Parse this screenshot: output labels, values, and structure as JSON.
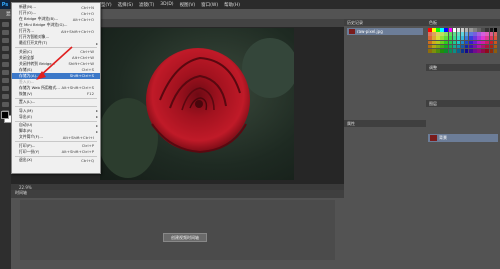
{
  "app": {
    "logo": "Ps"
  },
  "menubar": [
    "文件(F)",
    "编辑(E)",
    "图像(I)",
    "图层(L)",
    "类型(Y)",
    "选择(S)",
    "滤镜(T)",
    "3D(D)",
    "视图(V)",
    "窗口(W)",
    "帮助(H)"
  ],
  "optbar": [
    "显示变换控件"
  ],
  "file_menu": [
    {
      "label": "新建(N)...",
      "shortcut": "Ctrl+N"
    },
    {
      "label": "打开(O)...",
      "shortcut": "Ctrl+O"
    },
    {
      "label": "在 Bridge 中浏览(B)...",
      "shortcut": "Alt+Ctrl+O"
    },
    {
      "label": "在 Mini Bridge 中浏览(G)..."
    },
    {
      "label": "打开为...",
      "shortcut": "Alt+Shift+Ctrl+O"
    },
    {
      "label": "打开为智能对象..."
    },
    {
      "label": "最近打开文件(T)",
      "submenu": true
    },
    {
      "sep": true
    },
    {
      "label": "关闭(C)",
      "shortcut": "Ctrl+W"
    },
    {
      "label": "关闭全部",
      "shortcut": "Alt+Ctrl+W"
    },
    {
      "label": "关闭并转到 Bridge...",
      "shortcut": "Shift+Ctrl+W"
    },
    {
      "label": "存储(S)",
      "shortcut": "Ctrl+S"
    },
    {
      "label": "存储为(A)...",
      "shortcut": "Shift+Ctrl+S",
      "highlight": true
    },
    {
      "label": "签入(I)...",
      "disabled": true
    },
    {
      "label": "存储为 Web 所用格式...",
      "shortcut": "Alt+Shift+Ctrl+S"
    },
    {
      "label": "恢复(V)",
      "shortcut": "F12"
    },
    {
      "sep": true
    },
    {
      "label": "置入(L)..."
    },
    {
      "sep": true
    },
    {
      "label": "导入(M)",
      "submenu": true
    },
    {
      "label": "导出(E)",
      "submenu": true
    },
    {
      "sep": true
    },
    {
      "label": "自动(U)",
      "submenu": true
    },
    {
      "label": "脚本(R)",
      "submenu": true
    },
    {
      "label": "文件简介(F)...",
      "shortcut": "Alt+Shift+Ctrl+I"
    },
    {
      "sep": true
    },
    {
      "label": "打印(P)...",
      "shortcut": "Ctrl+P"
    },
    {
      "label": "打印一份(Y)",
      "shortcut": "Alt+Shift+Ctrl+P"
    },
    {
      "sep": true
    },
    {
      "label": "退出(X)",
      "shortcut": "Ctrl+Q"
    }
  ],
  "history": {
    "tab": "历史记录",
    "item": "raw-pixel.jpg"
  },
  "swatches": {
    "tab": "色板"
  },
  "adjust": {
    "tab": "调整"
  },
  "layers": {
    "tab": "图层",
    "item": "背景"
  },
  "props": {
    "tab": "属性"
  },
  "status": {
    "zoom": "22.9%"
  },
  "timeline": {
    "tab": "时间轴",
    "button": "创建视频时间轴"
  },
  "colors": {
    "fg": "#000000",
    "bg": "#ffffff",
    "accent": "#3c78c8",
    "swatches": [
      "#ff0000",
      "#ffff00",
      "#00ff00",
      "#00ffff",
      "#0000ff",
      "#ff00ff",
      "#ffffff",
      "#e6e6e6",
      "#cccccc",
      "#b3b3b3",
      "#999999",
      "#808080",
      "#666666",
      "#4d4d4d",
      "#333333",
      "#1a1a1a",
      "#000000",
      "#ff6666",
      "#ffcc66",
      "#99ff66"
    ]
  }
}
